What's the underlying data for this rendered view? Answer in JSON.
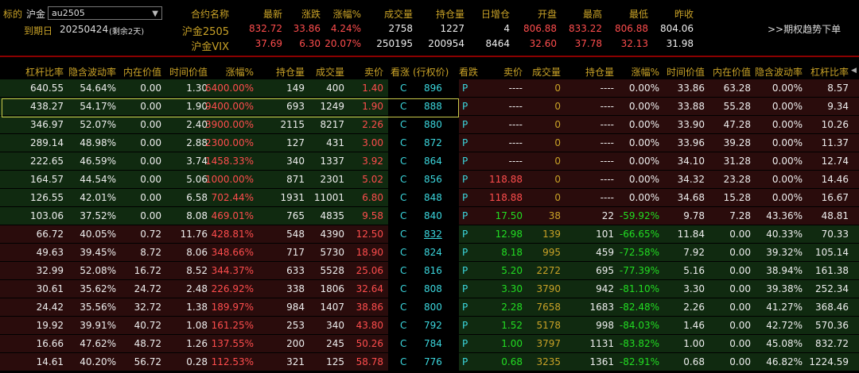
{
  "top": {
    "underlying_label": "标的",
    "exchange_label": "沪金",
    "contract_select": "au2505",
    "expiry_label": "到期日",
    "expiry_date": "20250424",
    "remaining": "(剩余2天)",
    "trend_button": ">>期权趋势下单",
    "headers": [
      "合约名称",
      "最新",
      "涨跌",
      "涨幅%",
      "成交量",
      "持仓量",
      "日增仓",
      "开盘",
      "最高",
      "最低",
      "昨收"
    ],
    "quotes": [
      [
        "沪金2505",
        "832.72",
        "33.86",
        "4.24%",
        "2758",
        "1227",
        "4",
        "806.88",
        "833.22",
        "806.88",
        "804.06"
      ],
      [
        "沪金VIX",
        "37.69",
        "6.30",
        "20.07%",
        "250195",
        "200954",
        "8464",
        "32.60",
        "37.78",
        "32.13",
        "31.98"
      ]
    ]
  },
  "table": {
    "headers_left": [
      "杠杆比率",
      "隐含波动率",
      "内在价值",
      "时间价值",
      "涨幅%",
      "持仓量",
      "成交量",
      "卖价"
    ],
    "headers_mid": [
      "看涨",
      "(行权价)",
      "看跌"
    ],
    "headers_right": [
      "卖价",
      "成交量",
      "持仓量",
      "涨幅%",
      "时间价值",
      "内在价值",
      "隐含波动率",
      "杠杆比率"
    ],
    "rows": [
      {
        "l": [
          "640.55",
          "54.64%",
          "0.00",
          "1.30",
          "6400.00%",
          "149",
          "400",
          "1.40"
        ],
        "c": "C",
        "k": "896",
        "p": "P",
        "r": [
          "----",
          "0",
          "----",
          "0.00%",
          "33.86",
          "63.28",
          "0.00%",
          "8.57"
        ]
      },
      {
        "l": [
          "438.27",
          "54.17%",
          "0.00",
          "1.90",
          "9400.00%",
          "693",
          "1249",
          "1.90"
        ],
        "c": "C",
        "k": "888",
        "p": "P",
        "r": [
          "----",
          "0",
          "----",
          "0.00%",
          "33.88",
          "55.28",
          "0.00%",
          "9.34"
        ]
      },
      {
        "l": [
          "346.97",
          "52.07%",
          "0.00",
          "2.40",
          "3900.00%",
          "2115",
          "8217",
          "2.26"
        ],
        "c": "C",
        "k": "880",
        "p": "P",
        "r": [
          "----",
          "0",
          "----",
          "0.00%",
          "33.90",
          "47.28",
          "0.00%",
          "10.26"
        ]
      },
      {
        "l": [
          "289.14",
          "48.98%",
          "0.00",
          "2.88",
          "2300.00%",
          "127",
          "431",
          "3.00"
        ],
        "c": "C",
        "k": "872",
        "p": "P",
        "r": [
          "----",
          "0",
          "----",
          "0.00%",
          "33.96",
          "39.28",
          "0.00%",
          "11.37"
        ]
      },
      {
        "l": [
          "222.65",
          "46.59%",
          "0.00",
          "3.74",
          "1458.33%",
          "340",
          "1337",
          "3.92"
        ],
        "c": "C",
        "k": "864",
        "p": "P",
        "r": [
          "----",
          "0",
          "----",
          "0.00%",
          "34.10",
          "31.28",
          "0.00%",
          "12.74"
        ]
      },
      {
        "l": [
          "164.57",
          "44.54%",
          "0.00",
          "5.06",
          "1000.00%",
          "871",
          "2301",
          "5.02"
        ],
        "c": "C",
        "k": "856",
        "p": "P",
        "r": [
          "118.88",
          "0",
          "----",
          "0.00%",
          "34.32",
          "23.28",
          "0.00%",
          "14.46"
        ]
      },
      {
        "l": [
          "126.55",
          "42.01%",
          "0.00",
          "6.58",
          "702.44%",
          "1931",
          "11001",
          "6.80"
        ],
        "c": "C",
        "k": "848",
        "p": "P",
        "r": [
          "118.88",
          "0",
          "----",
          "0.00%",
          "34.68",
          "15.28",
          "0.00%",
          "16.67"
        ]
      },
      {
        "l": [
          "103.06",
          "37.52%",
          "0.00",
          "8.08",
          "469.01%",
          "765",
          "4835",
          "9.58"
        ],
        "c": "C",
        "k": "840",
        "p": "P",
        "r": [
          "17.50",
          "38",
          "22",
          "-59.92%",
          "9.78",
          "7.28",
          "43.36%",
          "48.81"
        ]
      },
      {
        "l": [
          "66.72",
          "40.05%",
          "0.72",
          "11.76",
          "428.81%",
          "548",
          "4390",
          "12.50"
        ],
        "c": "C",
        "k": "832",
        "p": "P",
        "r": [
          "12.98",
          "139",
          "101",
          "-66.65%",
          "11.84",
          "0.00",
          "40.33%",
          "70.33"
        ]
      },
      {
        "l": [
          "49.63",
          "39.45%",
          "8.72",
          "8.06",
          "348.66%",
          "717",
          "5730",
          "18.90"
        ],
        "c": "C",
        "k": "824",
        "p": "P",
        "r": [
          "8.18",
          "995",
          "459",
          "-72.58%",
          "7.92",
          "0.00",
          "39.32%",
          "105.14"
        ]
      },
      {
        "l": [
          "32.99",
          "52.08%",
          "16.72",
          "8.52",
          "344.37%",
          "633",
          "5528",
          "25.06"
        ],
        "c": "C",
        "k": "816",
        "p": "P",
        "r": [
          "5.20",
          "2272",
          "695",
          "-77.39%",
          "5.16",
          "0.00",
          "38.94%",
          "161.38"
        ]
      },
      {
        "l": [
          "30.61",
          "35.62%",
          "24.72",
          "2.48",
          "226.92%",
          "338",
          "1806",
          "32.64"
        ],
        "c": "C",
        "k": "808",
        "p": "P",
        "r": [
          "3.30",
          "3790",
          "942",
          "-81.10%",
          "3.30",
          "0.00",
          "39.38%",
          "252.34"
        ]
      },
      {
        "l": [
          "24.42",
          "35.56%",
          "32.72",
          "1.38",
          "189.97%",
          "984",
          "1407",
          "38.86"
        ],
        "c": "C",
        "k": "800",
        "p": "P",
        "r": [
          "2.28",
          "7658",
          "1683",
          "-82.48%",
          "2.26",
          "0.00",
          "41.27%",
          "368.46"
        ]
      },
      {
        "l": [
          "19.92",
          "39.91%",
          "40.72",
          "1.08",
          "161.25%",
          "253",
          "340",
          "43.80"
        ],
        "c": "C",
        "k": "792",
        "p": "P",
        "r": [
          "1.52",
          "5178",
          "998",
          "-84.03%",
          "1.46",
          "0.00",
          "42.72%",
          "570.36"
        ]
      },
      {
        "l": [
          "16.66",
          "47.62%",
          "48.72",
          "1.26",
          "137.55%",
          "200",
          "245",
          "50.26"
        ],
        "c": "C",
        "k": "784",
        "p": "P",
        "r": [
          "1.00",
          "3797",
          "1131",
          "-83.82%",
          "1.00",
          "0.00",
          "45.08%",
          "832.72"
        ]
      },
      {
        "l": [
          "14.61",
          "40.20%",
          "56.72",
          "0.28",
          "112.53%",
          "321",
          "125",
          "58.78"
        ],
        "c": "C",
        "k": "776",
        "p": "P",
        "r": [
          "0.68",
          "3235",
          "1361",
          "-82.91%",
          "0.68",
          "0.00",
          "46.82%",
          "1224.59"
        ]
      }
    ]
  }
}
